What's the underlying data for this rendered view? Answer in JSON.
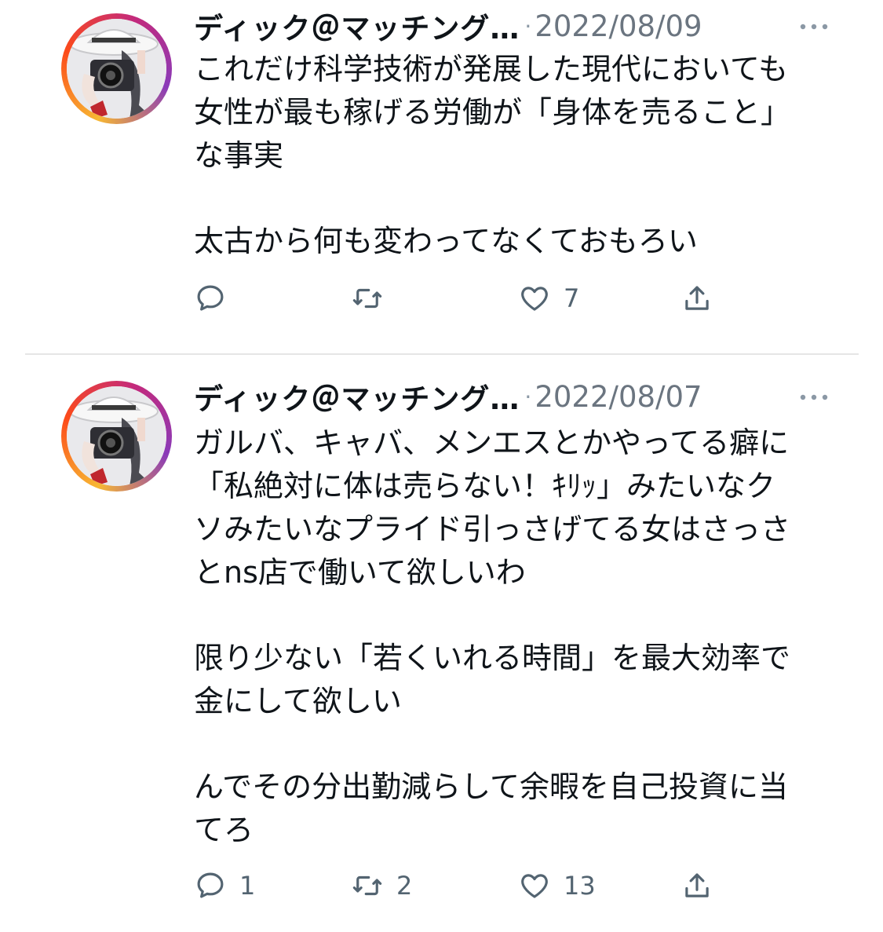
{
  "tweets": [
    {
      "author": "ディック＠マッチング…",
      "separator": "·",
      "date": "2022/08/09",
      "paragraphs": [
        [
          "これだけ科学技術が発展した現代においても",
          "女性が最も稼げる労働が「身体を売ること」",
          "な事実"
        ],
        [
          "太古から何も変わってなくておもろい"
        ]
      ],
      "counts": {
        "replies": "",
        "retweets": "",
        "likes": "7"
      }
    },
    {
      "author": "ディック＠マッチング…",
      "separator": "·",
      "date": "2022/08/07",
      "paragraphs": [
        [
          "ガルバ、キャバ、メンエスとかやってる癖に",
          "「私絶対に体は売らない！ｷﾘｯ」みたいなク",
          "ソみたいなプライド引っさげてる女はさっさ",
          "とns店で働いて欲しいわ"
        ],
        [
          "限り少ない「若くいれる時間」を最大効率で",
          "金にして欲しい"
        ],
        [
          "んでその分出勤減らして余暇を自己投資に当",
          "てろ"
        ]
      ],
      "counts": {
        "replies": "1",
        "retweets": "2",
        "likes": "13"
      }
    }
  ],
  "icons": {
    "avatar": "profile-photo-hat-camera",
    "more": "more-horizontal-icon",
    "reply": "reply-bubble-icon",
    "retweet": "retweet-icon",
    "like": "heart-icon",
    "share": "share-upload-icon"
  },
  "colors": {
    "text": "#0f1419",
    "secondary": "#6b7580",
    "icon": "#536471",
    "divider": "#e6e6e6"
  }
}
